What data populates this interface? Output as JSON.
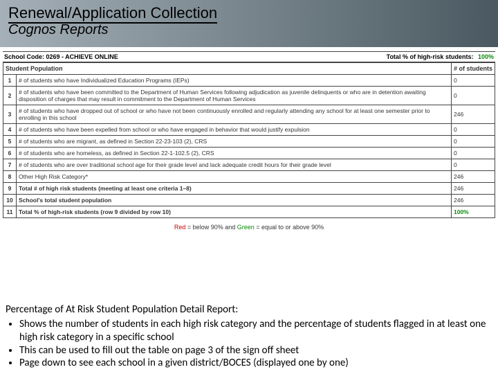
{
  "header": {
    "title": "Renewal/Application Collection",
    "subtitle": "Cognos Reports"
  },
  "report": {
    "school_code_label": "School Code: 0269 - ACHIEVE ONLINE",
    "total_label": "Total % of high-risk students:",
    "total_value": "100%",
    "col_header_left": "Student Population",
    "col_header_right": "# of students",
    "rows": [
      {
        "n": "1",
        "text": "# of students who have Individualized Education Programs (IEPs)",
        "val": "0"
      },
      {
        "n": "2",
        "text": "# of students who have been committed to the Department of Human Services following adjudication as juvenile delinquents or who are in detention awaiting disposition of charges that may result in commitment to the Department of Human Services",
        "val": "0"
      },
      {
        "n": "3",
        "text": "# of students who have dropped out of school or who have not been continuously enrolled and regularly attending any school for at least one semester prior to enrolling in this school",
        "val": "246"
      },
      {
        "n": "4",
        "text": "# of students who have been expelled from school or who have engaged in behavior that would justify expulsion",
        "val": "0"
      },
      {
        "n": "5",
        "text": "# of students who are migrant, as defined in Section 22-23-103 (2), CRS",
        "val": "0"
      },
      {
        "n": "6",
        "text": "# of students who are homeless, as defined in Section 22-1-102.5 (2), CRS",
        "val": "0"
      },
      {
        "n": "7",
        "text": "# of students who are over traditional school age for their grade level and lack adequate credit hours for their grade level",
        "val": "0"
      },
      {
        "n": "8",
        "text": "Other High Risk Category*",
        "val": "246"
      },
      {
        "n": "9",
        "text": "Total # of high risk students (meeting at least one criteria 1–8)",
        "val": "246",
        "bold": true
      },
      {
        "n": "10",
        "text": "School's total student population",
        "val": "246",
        "bold": true
      },
      {
        "n": "11",
        "text": "Total % of high-risk students (row 9 divided by row 10)",
        "val": "100%",
        "bold": true,
        "green": true
      }
    ],
    "legend": {
      "red": "Red",
      "red_desc": "= below 90% and",
      "green": "Green",
      "green_desc": "= equal to or above 90%"
    }
  },
  "bottom": {
    "title": "Percentage of At Risk Student Population Detail Report:",
    "bullets": [
      "Shows the number of students in each high risk category and the percentage of students flagged in at least one high risk category in a specific school",
      "This can be used to fill out the table on page 3 of the sign off sheet",
      "Page down to see each school in a given district/BOCES (displayed one by one)"
    ]
  }
}
